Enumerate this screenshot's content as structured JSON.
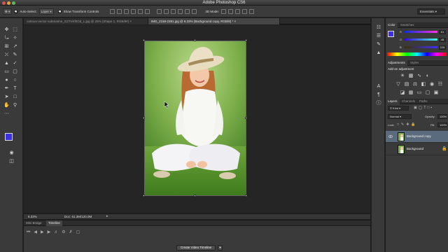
{
  "app": {
    "title": "Adobe Photoshop CS6",
    "workspace": "Essentials"
  },
  "options_bar": {
    "auto_select_label": "Auto-Select:",
    "auto_select_value": "Layer",
    "show_transform_label": "Show Transform Controls",
    "mode_3d_label": "3D Mode:"
  },
  "tabs": [
    {
      "label": "cartoon-vector-submarine_G2TVKf0Od_L.jpg @ 25% (Shape 1, RGB/8#) ×",
      "active": false
    },
    {
      "label": "IMG_2158-2391.jpg @ 8.33% (Background copy, RGB/8) * ×",
      "active": true
    }
  ],
  "status": {
    "zoom": "8.33%",
    "doc": "Doc: 61.3M/120.0M"
  },
  "bottom_panel": {
    "tabs": [
      {
        "label": "Mini Bridge",
        "active": false
      },
      {
        "label": "Timeline",
        "active": true
      }
    ],
    "create_button": "Create Video Timeline"
  },
  "color_panel": {
    "tabs": [
      {
        "label": "Color",
        "active": true
      },
      {
        "label": "Swatches",
        "active": false
      }
    ],
    "channels": [
      {
        "name": "R",
        "value": "61"
      },
      {
        "name": "G",
        "value": "48"
      },
      {
        "name": "B",
        "value": "226"
      }
    ],
    "foreground": "#3d30e2",
    "background": "#ffffff"
  },
  "adjustments_panel": {
    "tabs": [
      {
        "label": "Adjustments",
        "active": true
      },
      {
        "label": "Styles",
        "active": false
      }
    ],
    "heading": "Add an adjustment"
  },
  "layers_panel": {
    "tabs": [
      {
        "label": "Layers",
        "active": true
      },
      {
        "label": "Channels",
        "active": false
      },
      {
        "label": "Paths",
        "active": false
      }
    ],
    "kind_label": "Kind",
    "blend_mode": "Normal",
    "opacity_label": "Opacity:",
    "opacity": "100%",
    "lock_label": "Lock:",
    "fill_label": "Fill:",
    "fill": "100%",
    "layers": [
      {
        "name": "Background copy",
        "selected": true
      },
      {
        "name": "Background",
        "selected": false
      }
    ]
  }
}
